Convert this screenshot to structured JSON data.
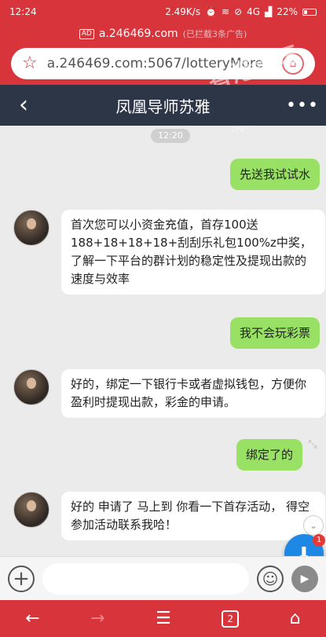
{
  "status": {
    "time": "12:24",
    "speed": "2.49K/s",
    "network": "4G",
    "battery": "22%"
  },
  "browser": {
    "domain": "a.246469.com",
    "blocked_ads": "(已拦截3条广告)",
    "ad_icon": "AD",
    "url": "a.246469.com:5067/lotteryMore",
    "watermark": "香港论坛",
    "watermark_sub": "ngaoluntan.com"
  },
  "chat": {
    "title": "凤凰导师苏雅",
    "back_icon": "back-arrow-icon",
    "more_icon": "more-icon",
    "timestamp": "12:20",
    "messages": [
      {
        "side": "out",
        "text": "先送我试试水"
      },
      {
        "side": "in",
        "text": "首次您可以小资金充值，首存100送188+18+18+18+刮刮乐礼包100%z中奖，了解一下平台的群计划的稳定性及提现出款的速度与效率"
      },
      {
        "side": "out",
        "text": "我不会玩彩票"
      },
      {
        "side": "in",
        "text": "好的，绑定一下银行卡或者虚拟钱包，方便你盈利时提现出款，彩金的申请。"
      },
      {
        "side": "out",
        "text": "绑定了的"
      },
      {
        "side": "in",
        "text": "好的 申请了 马上到 你看一下首存活动， 得空参加活动联系我哈！"
      }
    ]
  },
  "input": {
    "placeholder": ""
  },
  "float_badge": "1",
  "tab_count": "2",
  "colors": {
    "brand_red": "#d8343b",
    "header_dark": "#2d3646",
    "bubble_green": "#98e165"
  }
}
